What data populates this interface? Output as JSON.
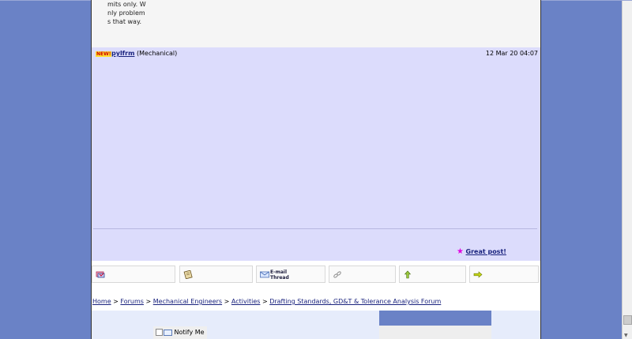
{
  "previous_post": {
    "text_lines": [
      "mits only. W",
      "nly problem",
      "s that way."
    ]
  },
  "post": {
    "new_badge": "NEW!",
    "author": "pylfrm",
    "author_role": "(Mechanical)",
    "timestamp": "12 Mar 20 04:07",
    "great_post_label": "Great post!"
  },
  "toolbar": {
    "items": [
      {
        "icon": "flag-icon",
        "label": ""
      },
      {
        "icon": "scroll-icon",
        "label": ""
      },
      {
        "icon": "email-icon",
        "label_line1": "E-mail",
        "label_line2": "Thread"
      },
      {
        "icon": "link-icon",
        "label": ""
      },
      {
        "icon": "arrow-up-icon",
        "label": ""
      },
      {
        "icon": "arrow-right-icon",
        "label": ""
      }
    ]
  },
  "breadcrumb": {
    "home": "Home",
    "forums": "Forums",
    "mechanical": "Mechanical Engineers",
    "activities": "Activities",
    "forum": "Drafting Standards, GD&T & Tolerance Analysis Forum",
    "separator": ">"
  },
  "notify": {
    "label": "Notify Me"
  },
  "colors": {
    "background": "#6a82c6",
    "post_bg": "#dcdcfc",
    "link": "#1a237e",
    "star": "#e100e1",
    "new_badge": "#ffe033"
  }
}
